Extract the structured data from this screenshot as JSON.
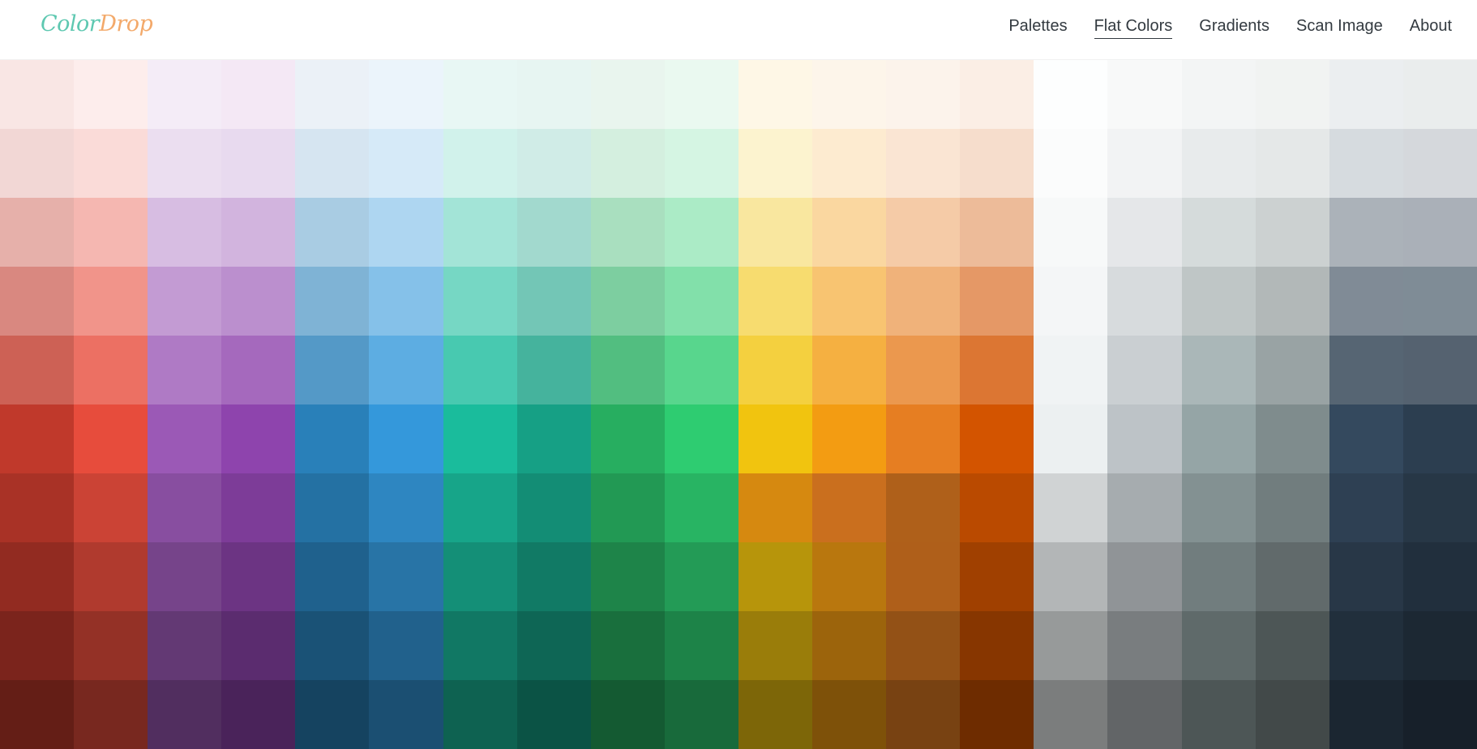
{
  "header": {
    "logo_part1": "Color",
    "logo_part2": "Drop",
    "nav": [
      "Palettes",
      "Flat Colors",
      "Gradients",
      "Scan Image",
      "About"
    ],
    "active_nav": "Flat Colors"
  },
  "swatches": [
    [
      "#F9E6E4",
      "#FDEDEC",
      "#F4ECF7",
      "#F4E8F5",
      "#EBF1F7",
      "#EBF4FB",
      "#E8F7F4",
      "#E7F5F2",
      "#E9F5EE",
      "#EAF9F0",
      "#FEF7E6",
      "#FDF5EA",
      "#FCF3EB",
      "#FBEEE5",
      "#FDFEFE",
      "#F8F9F9",
      "#F3F5F5",
      "#F1F3F2",
      "#EBEEF0",
      "#EAEDED"
    ],
    [
      "#F2D7D5",
      "#FADBD8",
      "#EBDEF0",
      "#E8DAEF",
      "#D6E5F1",
      "#D6EAF8",
      "#D1F2EB",
      "#D0ECE7",
      "#D4EFDF",
      "#D5F5E3",
      "#FCF3CF",
      "#FDEBD0",
      "#FAE5D3",
      "#F6DDCC",
      "#FBFCFC",
      "#F2F3F4",
      "#E8EBEC",
      "#E5E8E8",
      "#D6DBDF",
      "#D5D8DC"
    ],
    [
      "#E6B0AA",
      "#F5B7B1",
      "#D7BDE2",
      "#D2B4DE",
      "#A9CCE3",
      "#AED6F1",
      "#A3E4D7",
      "#A2D9CE",
      "#A9DFBF",
      "#ABEBC6",
      "#F9E79F",
      "#FAD7A0",
      "#F5CBA7",
      "#EDBB99",
      "#F7F9F9",
      "#E5E7E9",
      "#D5DBDB",
      "#CCD1D1",
      "#ABB2B9",
      "#AAB0B8"
    ],
    [
      "#D98880",
      "#F1948A",
      "#C39BD3",
      "#BB8FCE",
      "#7FB3D5",
      "#85C1E9",
      "#76D7C4",
      "#73C6B6",
      "#7DCEA0",
      "#82E0AA",
      "#F7DC6F",
      "#F8C471",
      "#F0B27A",
      "#E59866",
      "#F4F6F7",
      "#D7DBDD",
      "#BFC6C6",
      "#B2B8B8",
      "#808B96",
      "#7F8C96"
    ],
    [
      "#CD6155",
      "#EC7063",
      "#AF7AC5",
      "#A569BD",
      "#5499C7",
      "#5DADE2",
      "#48C9B0",
      "#45B39D",
      "#52BE80",
      "#58D68D",
      "#F4D03F",
      "#F5B041",
      "#EB984E",
      "#DC7633",
      "#F0F3F4",
      "#CACFD2",
      "#AAB7B8",
      "#99A3A4",
      "#566573",
      "#556270"
    ],
    [
      "#C0392B",
      "#E74C3C",
      "#9B59B6",
      "#8E44AD",
      "#2980B9",
      "#3498DB",
      "#1ABC9C",
      "#16A085",
      "#27AE60",
      "#2ECC71",
      "#F1C40F",
      "#F39C12",
      "#E67E22",
      "#D35400",
      "#ECF0F1",
      "#BDC3C7",
      "#95A5A6",
      "#7F8C8D",
      "#34495E",
      "#2C3E50"
    ],
    [
      "#A93226",
      "#CB4335",
      "#884EA0",
      "#7D3C98",
      "#2471A3",
      "#2E86C1",
      "#17A589",
      "#138D75",
      "#229954",
      "#28B463",
      "#D68910",
      "#CA6F1E",
      "#AF601A",
      "#BA4A00",
      "#D0D3D4",
      "#A6ACAF",
      "#839192",
      "#717D7E",
      "#2E4053",
      "#273746"
    ],
    [
      "#922B21",
      "#B03A2E",
      "#76448A",
      "#6C3483",
      "#1F618D",
      "#2874A6",
      "#148F77",
      "#117A65",
      "#1E8449",
      "#239B56",
      "#B7950B",
      "#B9770E",
      "#AF5F1A",
      "#A04000",
      "#B3B6B7",
      "#909497",
      "#717D7E",
      "#616A6B",
      "#283747",
      "#212F3D"
    ],
    [
      "#7B241C",
      "#943126",
      "#633974",
      "#5B2C6F",
      "#1A5276",
      "#21618C",
      "#117864",
      "#0E6655",
      "#196F3D",
      "#1D8348",
      "#9A7D0A",
      "#9C640C",
      "#935116",
      "#873600",
      "#979A9A",
      "#797D7F",
      "#5F6A6A",
      "#4D5656",
      "#212F3C",
      "#1C2833"
    ],
    [
      "#641E16",
      "#78281F",
      "#512E5F",
      "#4A235A",
      "#154360",
      "#1B4F72",
      "#0E6251",
      "#0B5345",
      "#145A32",
      "#186A3B",
      "#7D6608",
      "#7E5109",
      "#784212",
      "#6E2C00",
      "#7B7D7D",
      "#626567",
      "#4D5656",
      "#424949",
      "#1B2631",
      "#17202A"
    ]
  ]
}
